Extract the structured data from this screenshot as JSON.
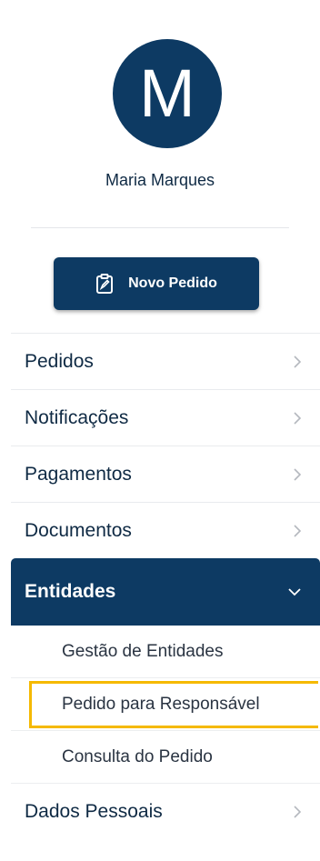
{
  "profile": {
    "avatar_initial": "M",
    "name": "Maria Marques"
  },
  "actions": {
    "new_order_label": "Novo Pedido",
    "new_order_icon": "clipboard-edit-icon"
  },
  "menu": {
    "items": [
      {
        "label": "Pedidos"
      },
      {
        "label": "Notificações"
      },
      {
        "label": "Pagamentos"
      },
      {
        "label": "Documentos"
      },
      {
        "label": "Entidades",
        "expanded": true,
        "children": [
          {
            "label": "Gestão de Entidades"
          },
          {
            "label": "Pedido para Responsável",
            "highlighted": true
          },
          {
            "label": "Consulta do Pedido"
          }
        ]
      },
      {
        "label": "Dados Pessoais"
      }
    ]
  },
  "colors": {
    "primary": "#0d3a63",
    "highlight": "#f5b900"
  }
}
